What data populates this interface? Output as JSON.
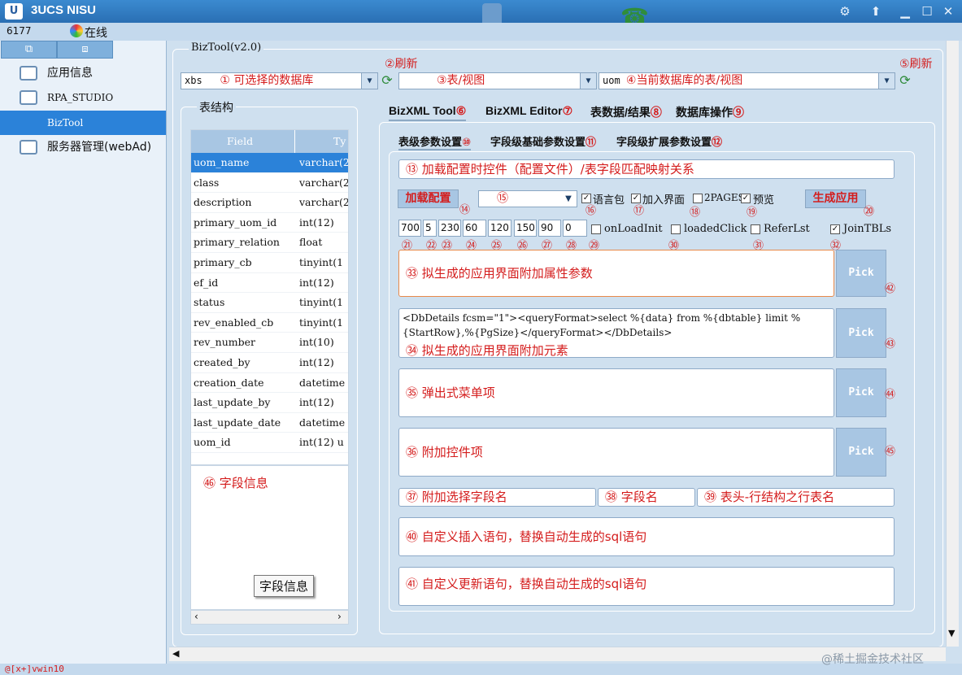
{
  "window": {
    "title": "3UCS NISU"
  },
  "status": {
    "id": "6177",
    "online": "在线"
  },
  "sidebar": {
    "items": [
      "应用信息",
      "RPA_STUDIO",
      "BizTool",
      "服务器管理(webAd)"
    ]
  },
  "main": {
    "version": "BizTool(v2.0)"
  },
  "toolbar": {
    "db_value": "xbs",
    "db_hint": "① 可选择的数据库",
    "refresh1": "②刷新",
    "table_hint": "③表/视图",
    "cur_value": "uom",
    "cur_hint": "④当前数据库的表/视图",
    "refresh2": "⑤刷新"
  },
  "struct": {
    "title": "表结构",
    "col_field": "Field",
    "col_type": "Ty",
    "rows": [
      [
        "uom_name",
        "varchar(2"
      ],
      [
        "class",
        "varchar(2"
      ],
      [
        "description",
        "varchar(2"
      ],
      [
        "primary_uom_id",
        "int(12)"
      ],
      [
        "primary_relation",
        "float"
      ],
      [
        "primary_cb",
        "tinyint(1"
      ],
      [
        "ef_id",
        "int(12)"
      ],
      [
        "status",
        "tinyint(1"
      ],
      [
        "rev_enabled_cb",
        "tinyint(1"
      ],
      [
        "rev_number",
        "int(10)"
      ],
      [
        "created_by",
        "int(12)"
      ],
      [
        "creation_date",
        "datetime"
      ],
      [
        "last_update_by",
        "int(12)"
      ],
      [
        "last_update_date",
        "datetime"
      ],
      [
        "uom_id",
        "int(12) u"
      ]
    ],
    "field_info": "㊻ 字段信息",
    "tooltip": "字段信息"
  },
  "tabs": {
    "t1": "BizXML Tool",
    "n1": "⑥",
    "t2": "BizXML Editor",
    "n2": "⑦",
    "t3": "表数据/结果",
    "n3": "⑧",
    "t4": "数据库操作",
    "n4": "⑨"
  },
  "subtabs": {
    "s1": "表级参数设置",
    "n1": "⑩",
    "s2": "字段级基础参数设置",
    "n2": "⑪",
    "s3": "字段级扩展参数设置",
    "n3": "⑫"
  },
  "config": {
    "map_field": "⑬  加载配置时控件（配置文件）/表字段匹配映射关系",
    "load_btn": "加载配置",
    "n14": "⑭",
    "n15": "⑮",
    "cb_lang": "语言包",
    "n16": "⑯",
    "cb_addui": "加入界面",
    "n17": "⑰",
    "cb_2pages": "2PAGES",
    "n18": "⑱",
    "cb_preview": "预览",
    "n19": "⑲",
    "gen_btn": "生成应用",
    "n20": "⑳",
    "nums": [
      "700",
      "5",
      "230",
      "60",
      "120",
      "150",
      "90",
      "0"
    ],
    "num_marks": [
      "㉑",
      "㉒",
      "㉓",
      "㉔",
      "㉕",
      "㉖",
      "㉗",
      "㉘"
    ],
    "cb_onload": "onLoadInit",
    "n29": "㉙",
    "cb_loaded": "loadedClick",
    "n30": "㉚",
    "cb_refer": "ReferLst",
    "n31": "㉛",
    "cb_join": "JoinTBLs",
    "n32": "㉜",
    "f33": "㉝  拟生成的应用界面附加属性参数",
    "n42": "㊷",
    "f34_code": "<DbDetails fcsm=\"1\"><queryFormat>select %{data} from %{dbtable} limit %{StartRow},%{PgSize}</queryFormat></DbDetails>",
    "f34": "㉞  拟生成的应用界面附加元素",
    "n43": "㊸",
    "f35": "㉟  弹出式菜单项",
    "n44": "㊹",
    "f36": "㊱  附加控件项",
    "n45": "㊺",
    "f37": "㊲  附加选择字段名",
    "f38": "㊳  字段名",
    "f39": "㊴   表头-行结构之行表名",
    "f40": "㊵  自定义插入语句，替换自动生成的sql语句",
    "f41": "㊶  自定义更新语句，替换自动生成的sql语句",
    "pick": "Pick"
  },
  "footer": {
    "cmd": "@[x+]vwin10",
    "watermark": "@稀土掘金技术社区"
  }
}
